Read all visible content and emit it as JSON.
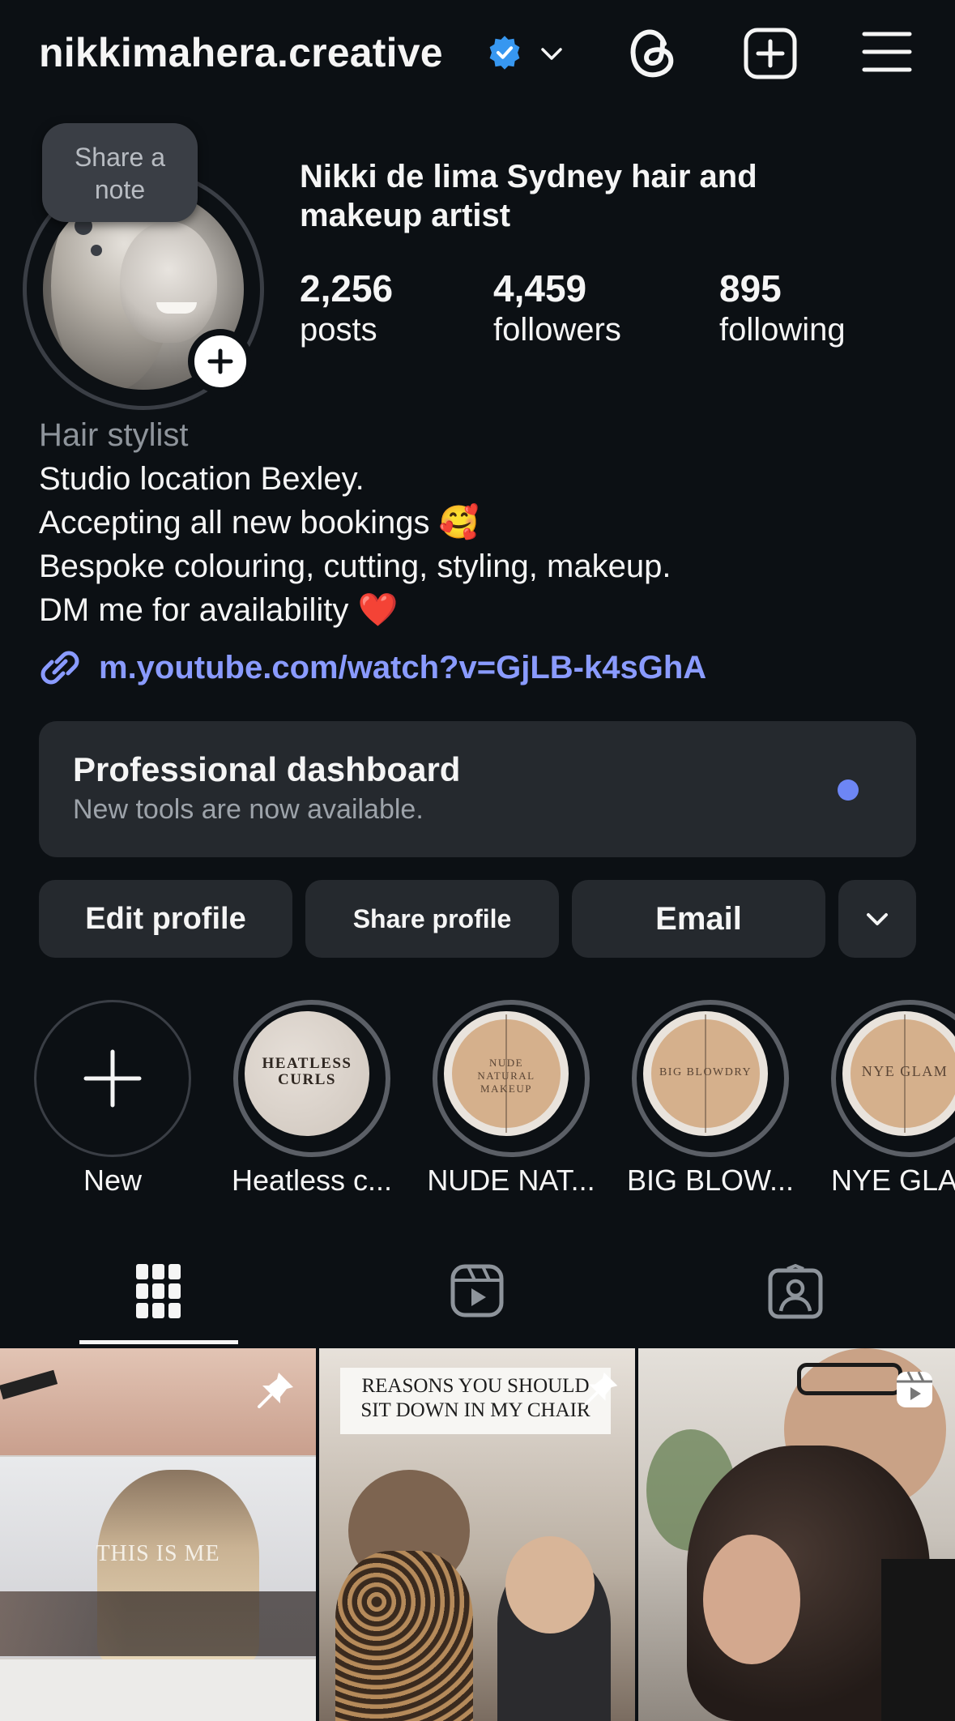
{
  "header": {
    "username": "nikkimahera.creative",
    "verified_icon": "verified-badge-icon",
    "chevron_icon": "chevron-down-icon",
    "threads_icon": "threads-icon",
    "create_icon": "create-post-icon",
    "menu_icon": "hamburger-menu-icon"
  },
  "profile": {
    "note_placeholder": "Share a note",
    "full_name": "Nikki de lima  Sydney hair and makeup artist",
    "stats": [
      {
        "value": "2,256",
        "label": "posts"
      },
      {
        "value": "4,459",
        "label": "followers"
      },
      {
        "value": "895",
        "label": "following"
      }
    ]
  },
  "bio": {
    "category": "Hair stylist",
    "lines": [
      "Studio location Bexley.",
      "Accepting all new bookings 🥰",
      "Bespoke colouring, cutting, styling, makeup.",
      "DM me for availability ❤️"
    ],
    "link": "m.youtube.com/watch?v=GjLB-k4sGhA"
  },
  "dashboard": {
    "title": "Professional dashboard",
    "subtitle": "New tools are now available."
  },
  "actions": {
    "edit": "Edit profile",
    "share": "Share profile",
    "email": "Email"
  },
  "highlights": [
    {
      "label": "New",
      "cover": ""
    },
    {
      "label": "Heatless c...",
      "cover": "HEATLESS CURLS"
    },
    {
      "label": "NUDE NAT...",
      "cover": "NUDE NATURAL MAKEUP"
    },
    {
      "label": "BIG BLOW...",
      "cover": "BIG BLOWDRY"
    },
    {
      "label": "NYE GLA",
      "cover": "NYE GLAM"
    }
  ],
  "tabs": [
    {
      "name": "grid",
      "icon": "grid-icon"
    },
    {
      "name": "reels",
      "icon": "reels-icon"
    },
    {
      "name": "tagged",
      "icon": "tagged-icon"
    }
  ],
  "posts": [
    {
      "overlay": "THIS IS ME",
      "pinned": true
    },
    {
      "overlay": "REASONS YOU SHOULD SIT DOWN IN MY CHAIR",
      "pinned": true
    },
    {
      "overlay": "",
      "type": "reel"
    }
  ],
  "colors": {
    "background": "#0c1014",
    "card": "#25292e",
    "link": "#8a9bff",
    "verified": "#3797f0",
    "notification_dot": "#6d86f5"
  }
}
